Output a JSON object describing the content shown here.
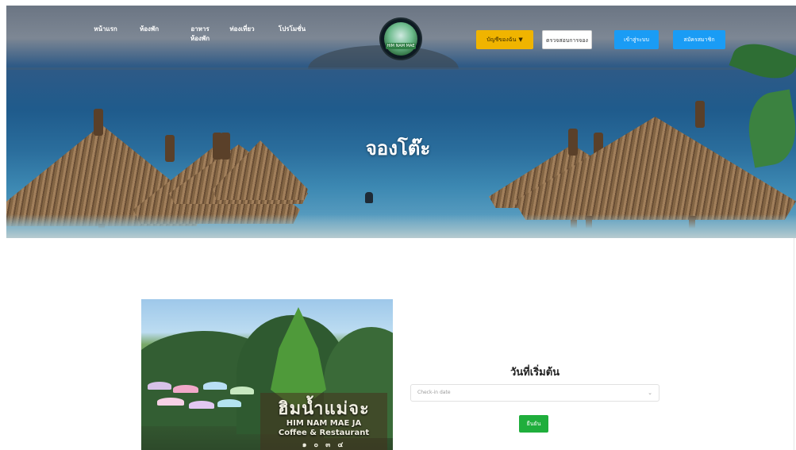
{
  "nav": {
    "links": [
      "หน้าแรก",
      "ห้องพัก",
      "อาหาร ห้องพัก",
      "ท่องเที่ยว",
      "โปรโมชั่น"
    ],
    "logo_text": "HIM NAM MAE JA",
    "account_label": "บัญชีของฉัน",
    "account_caret": "▼",
    "reserve_label": "ตรวจสอบการจอง",
    "login_label": "เข้าสู่ระบบ",
    "register_label": "สมัครสมาชิก"
  },
  "hero": {
    "title": "จองโต๊ะ"
  },
  "photo": {
    "sign_th": "ฮิมน้ำแม่จะ",
    "sign_en_1": "HIM NAM MAE JA",
    "sign_en_2": "Coffee & Restaurant",
    "sign_num": "๑ ๐ ๓ ๔"
  },
  "form": {
    "label": "วันที่เริ่มต้น",
    "date_placeholder": "Check-in date",
    "chevron": "⌄",
    "confirm_label": "ยืนยัน"
  },
  "colors": {
    "account_button": "#f0b400",
    "login_button": "#1a9cf5",
    "confirm_button": "#1fae3c"
  }
}
